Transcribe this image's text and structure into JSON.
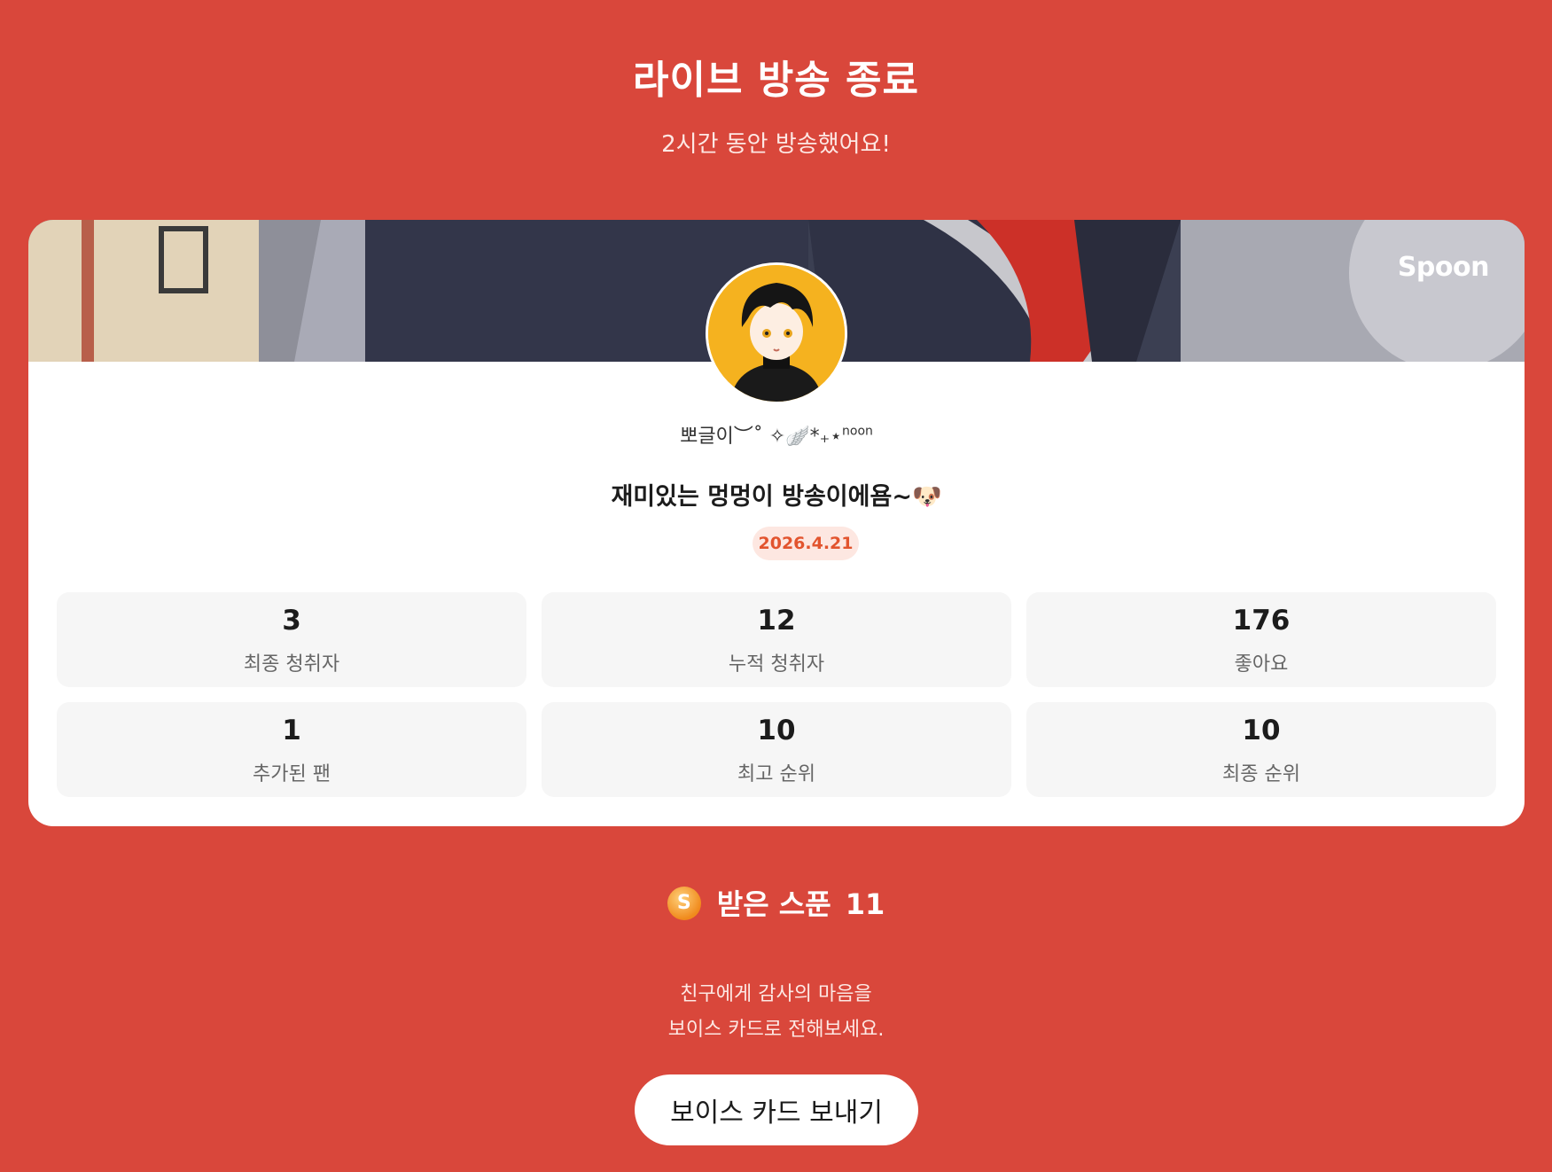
{
  "header": {
    "title": "라이브 방송 종료",
    "subtitle": "2시간 동안 방송했어요!"
  },
  "card": {
    "brand": "Spoon",
    "nickname": "뽀글이︶˚ ✧🪽*₊⋆",
    "nickname_suffix": "noon",
    "broadcast_title": "재미있는 멍멍이 방송이에욤~🐶",
    "date": "2026.4.21",
    "stats": [
      {
        "value": "3",
        "label": "최종 청취자"
      },
      {
        "value": "12",
        "label": "누적 청취자"
      },
      {
        "value": "176",
        "label": "좋아요"
      },
      {
        "value": "1",
        "label": "추가된 팬"
      },
      {
        "value": "10",
        "label": "최고 순위"
      },
      {
        "value": "10",
        "label": "최종 순위"
      }
    ]
  },
  "spoon": {
    "coin_symbol": "S",
    "label": "받은 스푼",
    "count": "11"
  },
  "thanks": {
    "line1": "친구에게 감사의 마음을",
    "line2": "보이스 카드로 전해보세요."
  },
  "voice_card_button": {
    "label": "보이스 카드 보내기"
  },
  "colors": {
    "background": "#d9473b",
    "date_badge_bg": "#fde7e1",
    "date_badge_text": "#e2542e",
    "stat_bg": "#f6f6f6"
  },
  "icons": {
    "coin": "spoon-coin-icon",
    "avatar": "profile-avatar"
  }
}
